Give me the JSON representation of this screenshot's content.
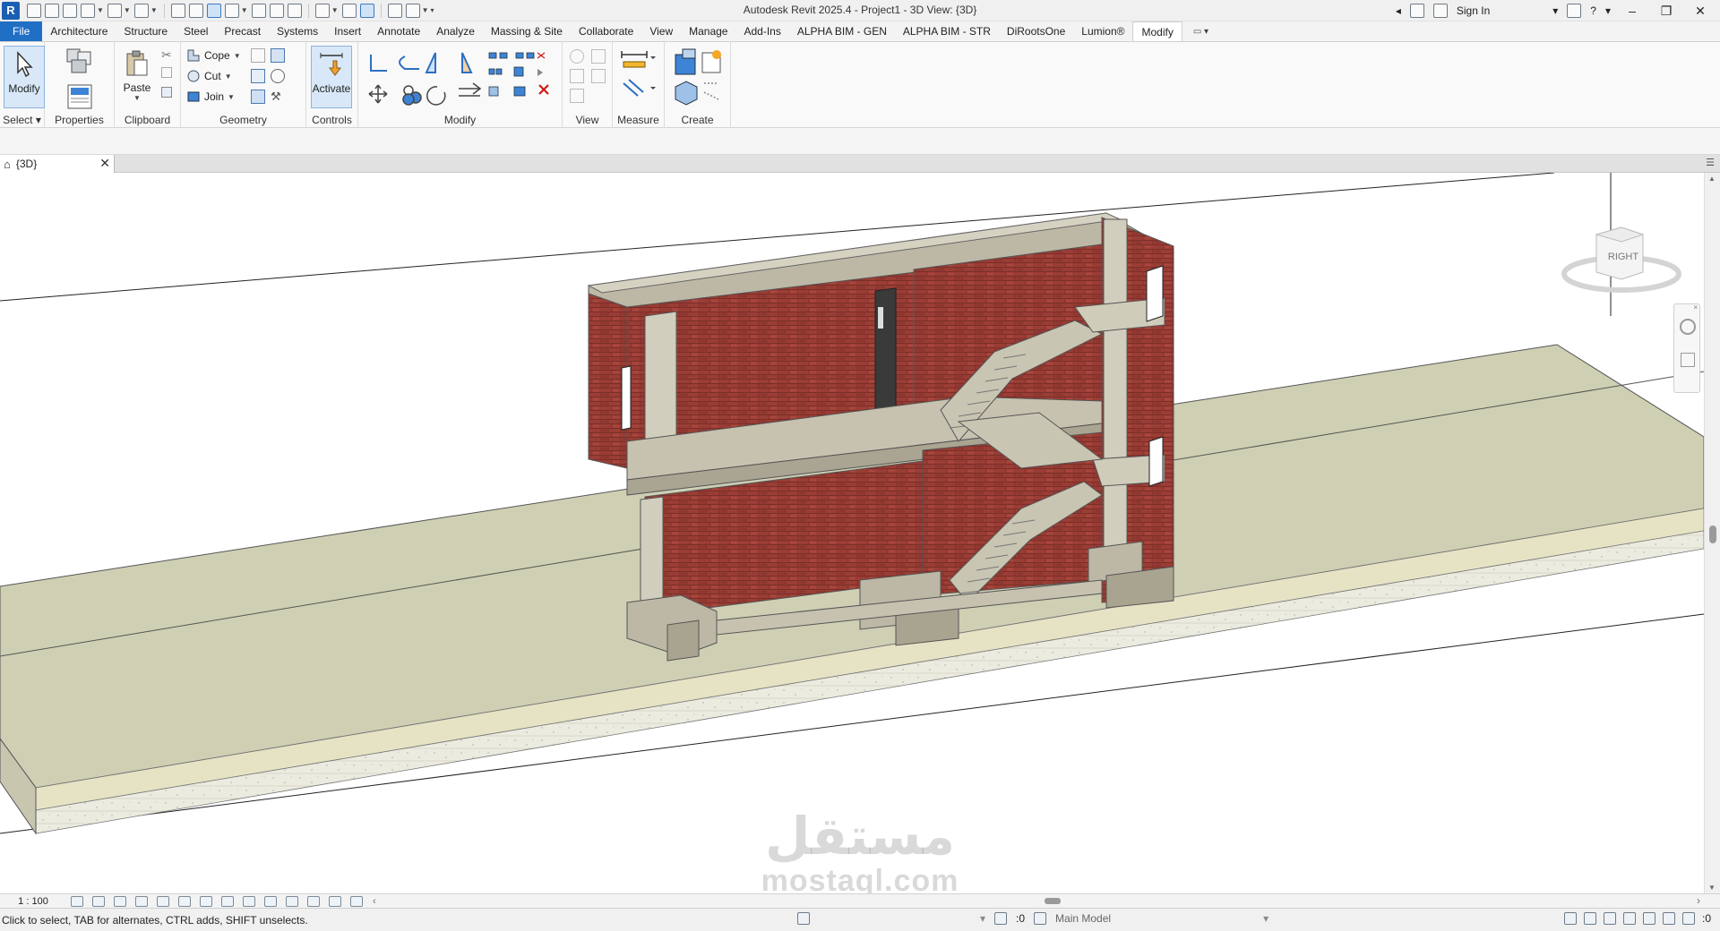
{
  "app": {
    "logo_letter": "R",
    "title": "Autodesk Revit 2025.4 - Project1 - 3D View: {3D}",
    "sign_in": "Sign In",
    "help": "?",
    "window_min": "–",
    "window_max": "❐",
    "window_close": "✕"
  },
  "tabs": [
    {
      "label": "File"
    },
    {
      "label": "Architecture"
    },
    {
      "label": "Structure"
    },
    {
      "label": "Steel"
    },
    {
      "label": "Precast"
    },
    {
      "label": "Systems"
    },
    {
      "label": "Insert"
    },
    {
      "label": "Annotate"
    },
    {
      "label": "Analyze"
    },
    {
      "label": "Massing & Site"
    },
    {
      "label": "Collaborate"
    },
    {
      "label": "View"
    },
    {
      "label": "Manage"
    },
    {
      "label": "Add-Ins"
    },
    {
      "label": "ALPHA BIM - GEN"
    },
    {
      "label": "ALPHA BIM - STR"
    },
    {
      "label": "DiRootsOne"
    },
    {
      "label": "Lumion®"
    },
    {
      "label": "Modify"
    }
  ],
  "ribbon": {
    "select": {
      "button": "Modify",
      "title": "Select"
    },
    "properties": {
      "title": "Properties"
    },
    "clipboard": {
      "paste": "Paste",
      "title": "Clipboard"
    },
    "geometry": {
      "cope": "Cope",
      "cut": "Cut",
      "join": "Join",
      "title": "Geometry"
    },
    "controls": {
      "activate": "Activate",
      "title": "Controls"
    },
    "modify": {
      "title": "Modify"
    },
    "view": {
      "title": "View"
    },
    "measure": {
      "title": "Measure"
    },
    "create": {
      "title": "Create"
    }
  },
  "view_tab": {
    "label": "{3D}"
  },
  "view_cube": {
    "face": "RIGHT"
  },
  "view_bar": {
    "scale": "1 : 100"
  },
  "status": {
    "message": "Click to select, TAB for alternates, CTRL adds, SHIFT unselects.",
    "worksets": ":0",
    "model": "Main Model",
    "filter_count": ":0"
  },
  "watermark": {
    "arabic": "مستقل",
    "latin": "mostaql.com"
  },
  "colors": {
    "file_tab": "#1f6fc5",
    "brick": "#9a3d35",
    "concrete": "#bdb8a6",
    "site": "#cfcfb4",
    "soil": "#ecebe0"
  }
}
